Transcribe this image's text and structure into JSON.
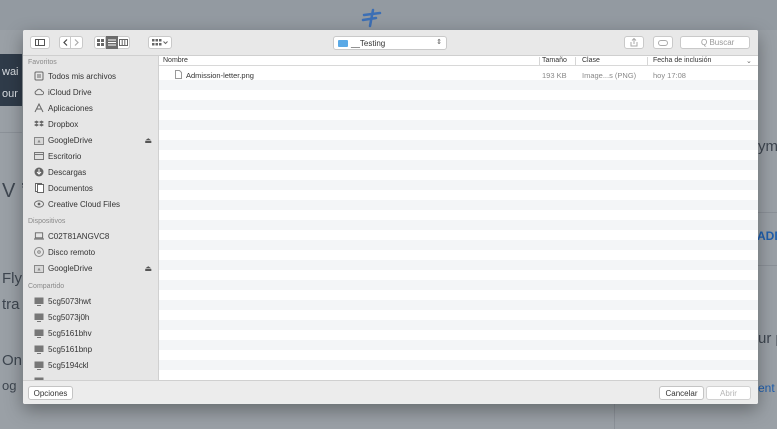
{
  "background": {
    "left_text_1": "wai",
    "left_text_2": "our",
    "left_text_3": "V ’",
    "left_text_4": "Fly",
    "left_text_5": "tra",
    "left_text_6": "Onl",
    "left_text_7": "og",
    "right_text_1": "ym",
    "right_text_2": "ADD",
    "right_text_3": "ur p",
    "right_text_4": "ent"
  },
  "toolbar": {
    "location_label": "__Testing",
    "search_placeholder": "Q Buscar"
  },
  "sidebar": {
    "favorites_title": "Favoritos",
    "favorites": [
      {
        "label": "Todos mis archivos",
        "icon": "all-files-icon"
      },
      {
        "label": "iCloud Drive",
        "icon": "cloud-icon"
      },
      {
        "label": "Aplicaciones",
        "icon": "applications-icon"
      },
      {
        "label": "Dropbox",
        "icon": "dropbox-icon"
      },
      {
        "label": "GoogleDrive",
        "icon": "drive-folder-icon",
        "eject": "⏏"
      },
      {
        "label": "Escritorio",
        "icon": "desktop-icon"
      },
      {
        "label": "Descargas",
        "icon": "download-icon"
      },
      {
        "label": "Documentos",
        "icon": "documents-icon"
      },
      {
        "label": "Creative Cloud Files",
        "icon": "creative-cloud-icon"
      }
    ],
    "devices_title": "Dispositivos",
    "devices": [
      {
        "label": "C02T81ANGVC8",
        "icon": "laptop-icon"
      },
      {
        "label": "Disco remoto",
        "icon": "disc-icon"
      },
      {
        "label": "GoogleDrive",
        "icon": "drive-folder-icon",
        "eject": "⏏"
      }
    ],
    "shared_title": "Compartido",
    "shared": [
      {
        "label": "5cg5073hwt",
        "icon": "computer-icon"
      },
      {
        "label": "5cg5073j0h",
        "icon": "computer-icon"
      },
      {
        "label": "5cg5161bhv",
        "icon": "computer-icon"
      },
      {
        "label": "5cg5161bnp",
        "icon": "computer-icon"
      },
      {
        "label": "5cg5194ckl",
        "icon": "computer-icon"
      }
    ]
  },
  "list": {
    "columns": {
      "name": "Nombre",
      "size": "Tamaño",
      "kind": "Clase",
      "date": "Fecha de inclusión"
    },
    "files": [
      {
        "name": "Admission-letter.png",
        "size": "193 KB",
        "kind": "Image...s (PNG)",
        "date": "hoy 17:08"
      }
    ]
  },
  "footer": {
    "options_label": "Opciones",
    "cancel_label": "Cancelar",
    "open_label": "Abrir"
  }
}
